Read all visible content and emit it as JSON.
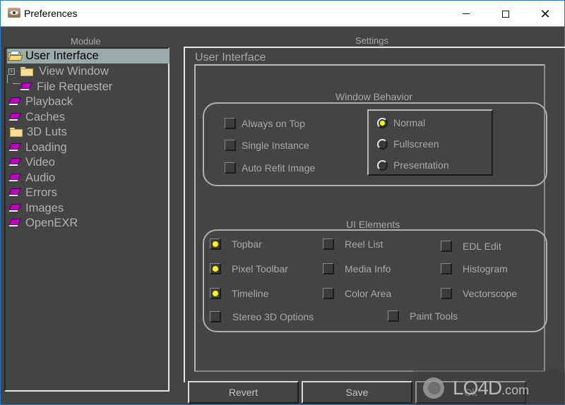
{
  "window": {
    "title": "Preferences",
    "controls": {
      "minimize": "minimize",
      "maximize": "maximize",
      "close": "close"
    }
  },
  "module": {
    "label": "Module",
    "items": [
      {
        "label": "User Interface",
        "icon": "open-folder-icon",
        "selected": true
      },
      {
        "label": "View Window",
        "icon": "folder-icon",
        "expander": "+",
        "indent": 1
      },
      {
        "label": "File Requester",
        "icon": "book-icon",
        "indent": 2
      },
      {
        "label": "Playback",
        "icon": "book-icon"
      },
      {
        "label": "Caches",
        "icon": "book-icon"
      },
      {
        "label": "3D Luts",
        "icon": "folder-icon"
      },
      {
        "label": "Loading",
        "icon": "book-icon"
      },
      {
        "label": "Video",
        "icon": "book-icon"
      },
      {
        "label": "Audio",
        "icon": "book-icon"
      },
      {
        "label": "Errors",
        "icon": "book-icon"
      },
      {
        "label": "Images",
        "icon": "book-icon"
      },
      {
        "label": "OpenEXR",
        "icon": "book-icon"
      }
    ]
  },
  "settings": {
    "label": "Settings",
    "section_title": "User Interface",
    "window_behavior": {
      "title": "Window Behavior",
      "checkboxes": [
        {
          "label": "Always on Top",
          "checked": false
        },
        {
          "label": "Single Instance",
          "checked": false
        },
        {
          "label": "Auto Refit Image",
          "checked": false
        }
      ],
      "radios": [
        {
          "label": "Normal",
          "selected": true
        },
        {
          "label": "Fullscreen",
          "selected": false
        },
        {
          "label": "Presentation",
          "selected": false
        }
      ]
    },
    "ui_elements": {
      "title": "UI Elements",
      "checkboxes": [
        {
          "label": "Topbar",
          "checked": true
        },
        {
          "label": "Reel List",
          "checked": false
        },
        {
          "label": "EDL Edit",
          "checked": false
        },
        {
          "label": "Pixel Toolbar",
          "checked": true
        },
        {
          "label": "Media Info",
          "checked": false
        },
        {
          "label": "Histogram",
          "checked": false
        },
        {
          "label": "Timeline",
          "checked": true
        },
        {
          "label": "Color Area",
          "checked": false
        },
        {
          "label": "Vectorscope",
          "checked": false
        },
        {
          "label": "Stereo 3D Options",
          "checked": false
        },
        {
          "label": "Paint Tools",
          "checked": false
        }
      ]
    }
  },
  "buttons": {
    "revert": "Revert",
    "save": "Save",
    "ok": "Ok"
  },
  "watermark": {
    "text": "LO4D",
    "suffix": ".com"
  },
  "colors": {
    "background": "#444444",
    "text": "#a8a8a8",
    "selection": "#9aaaa8",
    "check_indicator": "#ffff00",
    "book_icon": "#c000c8"
  }
}
